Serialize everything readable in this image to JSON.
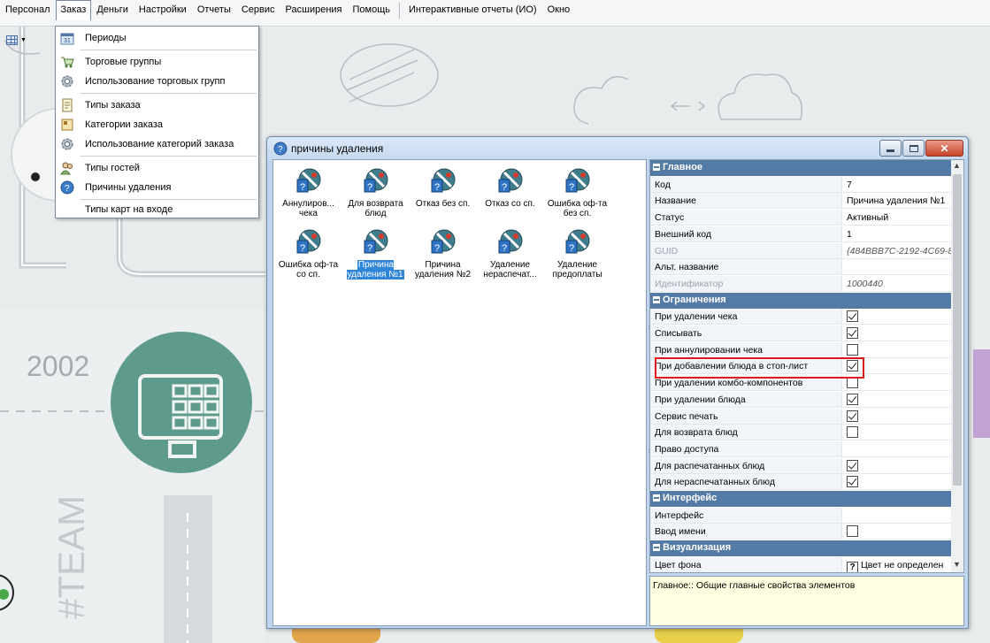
{
  "menubar": {
    "items": [
      "Персонал",
      "Заказ",
      "Деньги",
      "Настройки",
      "Отчеты",
      "Сервис",
      "Расширения",
      "Помощь"
    ],
    "items2": [
      "Интерактивные отчеты (ИО)",
      "Окно"
    ],
    "active_index": 1
  },
  "background": {
    "year_text": "2002",
    "team_text": "#TEAM",
    "accent": "#5f9b8c"
  },
  "dropdown": {
    "items": [
      {
        "label": "Периоды",
        "icon": "calendar-icon"
      },
      {
        "label": "Торговые группы",
        "icon": "cart-icon"
      },
      {
        "label": "Использование торговых групп",
        "icon": "gear-icon"
      },
      {
        "label": "Типы заказа",
        "icon": "document-icon"
      },
      {
        "label": "Категории заказа",
        "icon": "category-icon"
      },
      {
        "label": "Использование категорий заказа",
        "icon": "gear-icon"
      },
      {
        "label": "Типы гостей",
        "icon": "guests-icon"
      },
      {
        "label": "Причины удаления",
        "icon": "delete-reason-icon"
      },
      {
        "label": "Типы карт на входе",
        "icon": ""
      }
    ]
  },
  "dialog": {
    "title": "причины удаления",
    "icons": [
      {
        "label": "Аннулиров... чека",
        "selected": false
      },
      {
        "label": "Для возврата блюд",
        "selected": false
      },
      {
        "label": "Отказ без сп.",
        "selected": false
      },
      {
        "label": "Отказ со сп.",
        "selected": false
      },
      {
        "label": "Ошибка оф-та без сп.",
        "selected": false
      },
      {
        "label": "Ошибка оф-та со сп.",
        "selected": false
      },
      {
        "label": "Причина удаления №1",
        "selected": true
      },
      {
        "label": "Причина удаления №2",
        "selected": false
      },
      {
        "label": "Удаление нераспечат...",
        "selected": false
      },
      {
        "label": "Удаление предоплаты",
        "selected": false
      }
    ],
    "properties": [
      {
        "type": "category",
        "name": "Главное"
      },
      {
        "type": "text",
        "name": "Код",
        "value": "7"
      },
      {
        "type": "text",
        "name": "Название",
        "value": "Причина удаления №1"
      },
      {
        "type": "text",
        "name": "Статус",
        "value": "Активный"
      },
      {
        "type": "text",
        "name": "Внешний код",
        "value": "1"
      },
      {
        "type": "text",
        "name": "GUID",
        "value": "{484BBB7C-2192-4C69-8",
        "disabled": true
      },
      {
        "type": "text",
        "name": "Альт. название",
        "value": ""
      },
      {
        "type": "text",
        "name": "Идентификатор",
        "value": "1000440",
        "disabled": true
      },
      {
        "type": "category",
        "name": "Ограничения"
      },
      {
        "type": "check",
        "name": "При удалении чека",
        "checked": true
      },
      {
        "type": "check",
        "name": "Списывать",
        "checked": true
      },
      {
        "type": "check",
        "name": "При аннулировании чека",
        "checked": false
      },
      {
        "type": "check",
        "name": "При добавлении блюда в стоп-лист",
        "checked": true
      },
      {
        "type": "check",
        "name": "При удалении комбо-компонентов",
        "checked": false
      },
      {
        "type": "check",
        "name": "При удалении блюда",
        "checked": true
      },
      {
        "type": "check",
        "name": "Сервис печать",
        "checked": true
      },
      {
        "type": "check",
        "name": "Для возврата блюд",
        "checked": false
      },
      {
        "type": "text",
        "name": "Право доступа",
        "value": ""
      },
      {
        "type": "check",
        "name": "Для распечатанных блюд",
        "checked": true
      },
      {
        "type": "check",
        "name": "Для нераспечатанных блюд",
        "checked": true
      },
      {
        "type": "category",
        "name": "Интерфейс"
      },
      {
        "type": "text",
        "name": "Интерфейс",
        "value": ""
      },
      {
        "type": "check",
        "name": "Ввод имени",
        "checked": false
      },
      {
        "type": "category",
        "name": "Визуализация"
      },
      {
        "type": "color",
        "name": "Цвет фона",
        "value": "Цвет не определен",
        "mark": "?"
      }
    ],
    "description": "Главное:: Общие главные свойства элементов"
  }
}
